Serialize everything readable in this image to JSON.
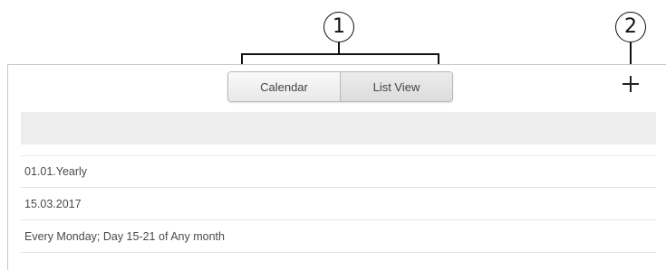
{
  "callouts": {
    "one": "1",
    "two": "2"
  },
  "toolbar": {
    "calendar_label": "Calendar",
    "list_view_label": "List View",
    "active_view": "List View",
    "add_icon": "plus-icon"
  },
  "list": {
    "items": [
      {
        "label": "01.01.Yearly"
      },
      {
        "label": "15.03.2017"
      },
      {
        "label": "Every Monday; Day 15-21 of Any month"
      }
    ]
  },
  "colors": {
    "header_bar": "#ededed",
    "active_toggle": "#dcdcdc",
    "divider": "#e3e3e3"
  }
}
